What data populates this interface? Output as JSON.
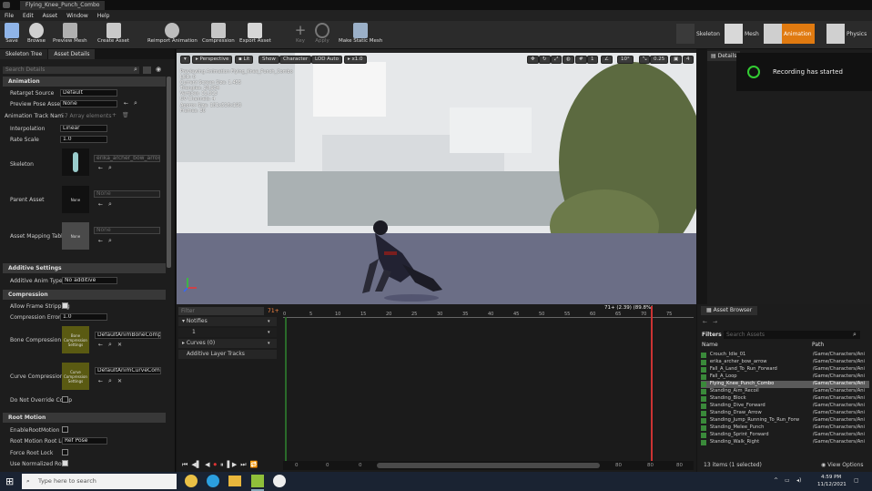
{
  "window": {
    "title": "Flying_Knee_Punch_Combo"
  },
  "menu": [
    "File",
    "Edit",
    "Asset",
    "Window",
    "Help"
  ],
  "toolbar": {
    "save": "Save",
    "browse": "Browse",
    "preview_mesh": "Preview Mesh",
    "create_asset": "Create Asset",
    "reimport": "Reimport Animation",
    "compression": "Compression",
    "export": "Export Asset",
    "key": "Key",
    "apply": "Apply",
    "make_static": "Make Static Mesh"
  },
  "modes": {
    "skeleton": "Skeleton",
    "mesh": "Mesh",
    "animation": "Animation",
    "physics": "Physics"
  },
  "left_tabs": [
    "Skeleton Tree",
    "Asset Details"
  ],
  "search_details": "Search Details",
  "sections": {
    "animation": "Animation",
    "additive": "Additive Settings",
    "compression": "Compression",
    "root": "Root Motion"
  },
  "props": {
    "retarget_source": "Retarget Source",
    "retarget_value": "Default",
    "preview_pose": "Preview Pose Asset",
    "preview_pose_value": "None",
    "anim_track": "Animation Track Nam",
    "anim_track_value": "57 Array elements",
    "interp": "Interpolation",
    "interp_value": "Linear",
    "rate": "Rate Scale",
    "rate_value": "1.0",
    "skeleton": "Skeleton",
    "skeleton_value": "erika_archer_bow_arrow_S",
    "parent": "Parent Asset",
    "parent_value": "None",
    "parent_thumb": "None",
    "mapping": "Asset Mapping Table",
    "mapping_value": "None",
    "mapping_thumb": "None",
    "additive_type": "Additive Anim Type",
    "additive_value": "No additive",
    "allow_strip": "Allow Frame Stripping",
    "comp_err": "Compression Error Th",
    "comp_err_value": "1.0",
    "bone_comp": "Bone Compression Se",
    "bone_comp_value": "DefaultAnimBoneCompre",
    "bone_thumb": "Bone Compression Settings",
    "curve_comp": "Curve Compression S",
    "curve_comp_value": "DefaultAnimCurveCompre",
    "curve_thumb": "Curve Compression Settings",
    "no_override": "Do Not Override Comp",
    "enable_root": "EnableRootMotion",
    "root_lock": "Root Motion Root Loc",
    "root_lock_value": "Ref Pose",
    "force_root": "Force Root Lock",
    "use_norm": "Use Normalized Root"
  },
  "viewport": {
    "perspective": "Perspective",
    "lit": "Lit",
    "show": "Show",
    "character": "Character",
    "lod": "LOD Auto",
    "speed": "x1.0",
    "grid_snap": "1",
    "rot_snap": "10°",
    "scale_snap": "0.25",
    "cam_speed": "4",
    "stats": [
      "Previewing Animation Flying_Knee_Punch_Combo",
      "LOD: 0",
      "Current Screen Size: 1.455",
      "Triangles: 20,934",
      "Vertices: 13,313",
      "UV Channels: 4",
      "Approx Size: 181x516x193",
      "Frames: 30"
    ]
  },
  "details_tab": "Details",
  "toast": "Recording has started",
  "timeline": {
    "filter": "Filter",
    "frame": "71+",
    "position": "71+ (2.39) (89.8%)",
    "ticks": [
      "0",
      "5",
      "10",
      "15",
      "20",
      "25",
      "30",
      "35",
      "40",
      "45",
      "50",
      "55",
      "60",
      "65",
      "70",
      "75"
    ],
    "notifies": "Notifies",
    "notify_track": "1",
    "curves": "Curves",
    "curves_count": "(0)",
    "additive_tracks": "Additive Layer Tracks",
    "bottom": [
      "0",
      "0",
      "0",
      "80",
      "80",
      "80"
    ]
  },
  "asset_browser": {
    "title": "Asset Browser",
    "filters": "Filters",
    "search": "Search Assets",
    "col_name": "Name",
    "col_path": "Path",
    "items": [
      {
        "name": "Crouch_Idle_01",
        "path": "/Game/Characters/Ani"
      },
      {
        "name": "erika_archer_bow_arrow",
        "path": "/Game/Characters/Ani"
      },
      {
        "name": "Fall_A_Land_To_Run_Forward",
        "path": "/Game/Characters/Ani"
      },
      {
        "name": "Fall_A_Loop",
        "path": "/Game/Characters/Ani"
      },
      {
        "name": "Flying_Knee_Punch_Combo",
        "path": "/Game/Characters/Ani"
      },
      {
        "name": "Standing_Aim_Recoil",
        "path": "/Game/Characters/Ani"
      },
      {
        "name": "Standing_Block",
        "path": "/Game/Characters/Ani"
      },
      {
        "name": "Standing_Dive_Forward",
        "path": "/Game/Characters/Ani"
      },
      {
        "name": "Standing_Draw_Arrow",
        "path": "/Game/Characters/Ani"
      },
      {
        "name": "Standing_Jump_Running_To_Run_Forw",
        "path": "/Game/Characters/Ani"
      },
      {
        "name": "Standing_Melee_Punch",
        "path": "/Game/Characters/Ani"
      },
      {
        "name": "Standing_Sprint_Forward",
        "path": "/Game/Characters/Ani"
      },
      {
        "name": "Standing_Walk_Right",
        "path": "/Game/Characters/Ani"
      }
    ],
    "count": "13 items (1 selected)",
    "view_options": "View Options"
  },
  "taskbar": {
    "search": "Type here to search",
    "time": "4:59 PM",
    "date": "11/12/2021"
  }
}
